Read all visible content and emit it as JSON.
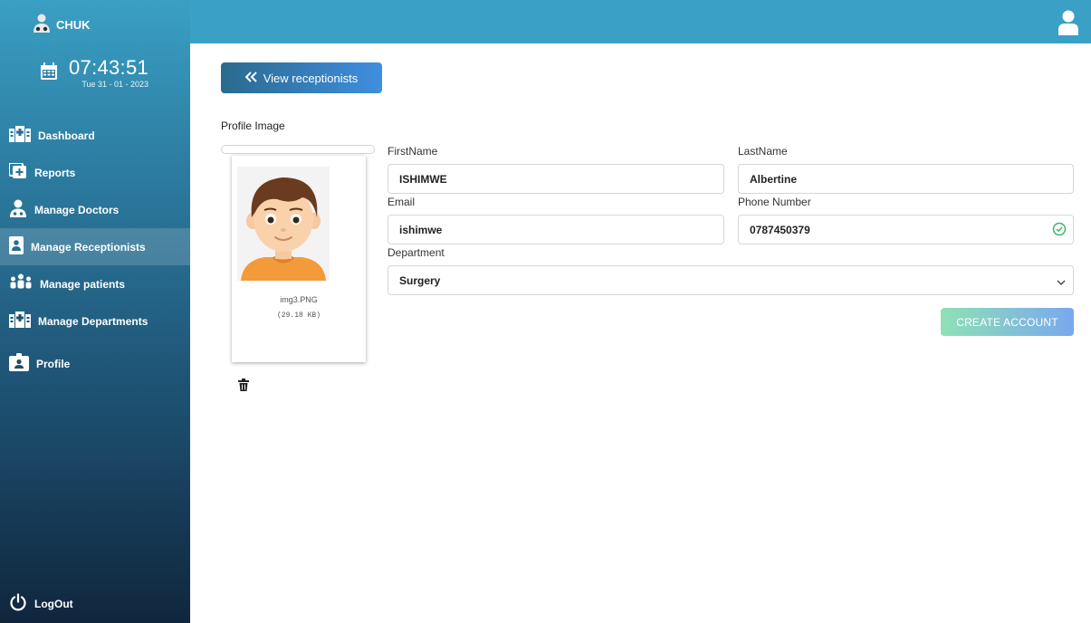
{
  "brand": {
    "name": "CHUK",
    "icon": "doctor-icon"
  },
  "clock": {
    "time": "07:43:51",
    "date": "Tue 31 - 01 - 2023",
    "icon": "calendar-icon"
  },
  "sidebar": {
    "items": [
      {
        "label": "Dashboard",
        "icon": "hospital-icon",
        "active": false
      },
      {
        "label": "Reports",
        "icon": "report-plus-icon",
        "active": false
      },
      {
        "label": "Manage Doctors",
        "icon": "doctor-icon",
        "active": false
      },
      {
        "label": "Manage Receptionists",
        "icon": "id-badge-icon",
        "active": true
      },
      {
        "label": "Manage patients",
        "icon": "people-icon",
        "active": false
      },
      {
        "label": "Manage Departments",
        "icon": "hospital-icon",
        "active": false
      },
      {
        "label": "Profile",
        "icon": "profile-card-icon",
        "active": false
      }
    ],
    "logout_label": "LogOut"
  },
  "toolbar": {
    "back_label": "View receptionists"
  },
  "profile_image": {
    "title": "Profile Image",
    "file_name": "img3.PNG",
    "file_size": "(29.18 KB)"
  },
  "form": {
    "first_name_label": "FirstName",
    "first_name_value": "ISHIMWE",
    "last_name_label": "LastName",
    "last_name_value": "Albertine",
    "email_label": "Email",
    "email_value": "ishimwe",
    "phone_label": "Phone Number",
    "phone_value": "0787450379",
    "department_label": "Department",
    "department_value": "Surgery",
    "create_label": "CREATE ACCOUNT"
  },
  "colors": {
    "topbar": "#3aa0c5",
    "accent": "#3f8fe0",
    "valid": "#3bb36b"
  }
}
